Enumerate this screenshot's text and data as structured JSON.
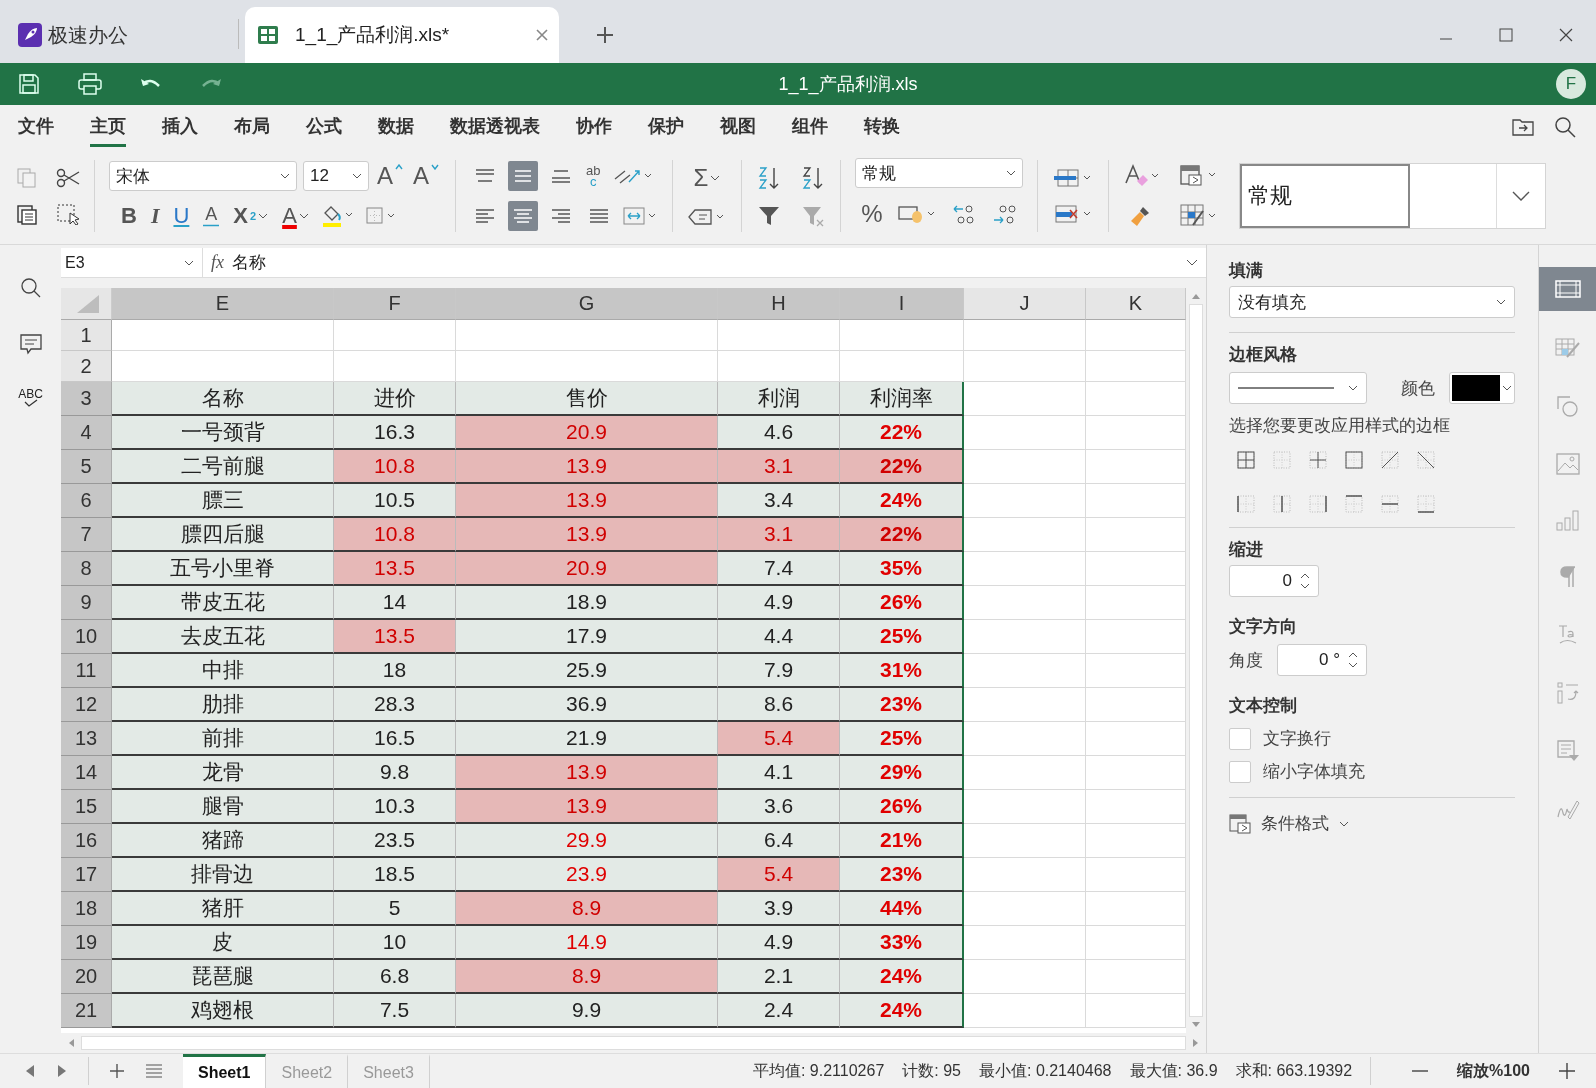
{
  "app_tab": {
    "label": "极速办公"
  },
  "doc_tab": {
    "label": "1_1_产品利润.xls*",
    "selected": true
  },
  "title_bar": {
    "title": "1_1_产品利润.xls",
    "avatar": "F",
    "redo_disabled": true
  },
  "menu": [
    {
      "label": "文件",
      "selected": false
    },
    {
      "label": "主页",
      "selected": true
    },
    {
      "label": "插入",
      "selected": false
    },
    {
      "label": "布局",
      "selected": false
    },
    {
      "label": "公式",
      "selected": false
    },
    {
      "label": "数据",
      "selected": false
    },
    {
      "label": "数据透视表",
      "selected": false
    },
    {
      "label": "协作",
      "selected": false
    },
    {
      "label": "保护",
      "selected": false
    },
    {
      "label": "视图",
      "selected": false
    },
    {
      "label": "组件",
      "selected": false
    },
    {
      "label": "转换",
      "selected": false
    }
  ],
  "toolbar": {
    "font": "宋体",
    "size": "12",
    "grow": "A",
    "shrink": "A",
    "bold": "B",
    "italic": "I",
    "underline": "U",
    "strike": "A",
    "subscript": "X",
    "subscript_mark": "2",
    "font_color": "A",
    "wrap_top": "ab",
    "wrap_bottom": "c",
    "sum": "Σ",
    "percent": "%",
    "number_format": "常规",
    "style_preview": "常规",
    "vertical_align": [
      {
        "selected": false
      },
      {
        "selected": true
      },
      {
        "selected": false
      }
    ],
    "horizontal_align": [
      {
        "selected": false
      },
      {
        "selected": true
      },
      {
        "selected": false
      },
      {
        "selected": false
      }
    ]
  },
  "formula_bar": {
    "cell": "E3",
    "fx": "fx",
    "value": "名称"
  },
  "side_tools": {
    "spell": "ABC"
  },
  "columns": [
    {
      "label": "E",
      "selected": true
    },
    {
      "label": "F",
      "selected": true
    },
    {
      "label": "G",
      "selected": true
    },
    {
      "label": "H",
      "selected": true
    },
    {
      "label": "I",
      "selected": true
    },
    {
      "label": "J",
      "selected": false
    },
    {
      "label": "K",
      "selected": false
    }
  ],
  "rows": [
    {
      "header": "1",
      "selected": false,
      "kind": "blank"
    },
    {
      "header": "2",
      "selected": false,
      "kind": "blank"
    },
    {
      "header": "3",
      "selected": true,
      "kind": "header",
      "cells": [
        {
          "text": "名称",
          "highlight": false,
          "red_text": false
        },
        {
          "text": "进价",
          "highlight": false,
          "red_text": false
        },
        {
          "text": "售价",
          "highlight": false,
          "red_text": false
        },
        {
          "text": "利润",
          "highlight": false,
          "red_text": false
        },
        {
          "text": "利润率",
          "highlight": false,
          "red_text": false
        }
      ]
    },
    {
      "header": "4",
      "selected": true,
      "kind": "data",
      "cells": [
        {
          "text": "一号颈背",
          "highlight": false,
          "red_text": false
        },
        {
          "text": "16.3",
          "highlight": false,
          "red_text": false
        },
        {
          "text": "20.9",
          "highlight": true,
          "red_text": true
        },
        {
          "text": "4.6",
          "highlight": false,
          "red_text": false
        },
        {
          "text": "22%",
          "highlight": false,
          "red_text": true
        }
      ]
    },
    {
      "header": "5",
      "selected": true,
      "kind": "data",
      "cells": [
        {
          "text": "二号前腿",
          "highlight": false,
          "red_text": false
        },
        {
          "text": "10.8",
          "highlight": true,
          "red_text": true
        },
        {
          "text": "13.9",
          "highlight": true,
          "red_text": true
        },
        {
          "text": "3.1",
          "highlight": true,
          "red_text": true
        },
        {
          "text": "22%",
          "highlight": true,
          "red_text": true
        }
      ]
    },
    {
      "header": "6",
      "selected": true,
      "kind": "data",
      "cells": [
        {
          "text": "膘三",
          "highlight": false,
          "red_text": false
        },
        {
          "text": "10.5",
          "highlight": false,
          "red_text": false
        },
        {
          "text": "13.9",
          "highlight": true,
          "red_text": true
        },
        {
          "text": "3.4",
          "highlight": false,
          "red_text": false
        },
        {
          "text": "24%",
          "highlight": false,
          "red_text": true
        }
      ]
    },
    {
      "header": "7",
      "selected": true,
      "kind": "data",
      "cells": [
        {
          "text": "膘四后腿",
          "highlight": false,
          "red_text": false
        },
        {
          "text": "10.8",
          "highlight": true,
          "red_text": true
        },
        {
          "text": "13.9",
          "highlight": true,
          "red_text": true
        },
        {
          "text": "3.1",
          "highlight": true,
          "red_text": true
        },
        {
          "text": "22%",
          "highlight": true,
          "red_text": true
        }
      ]
    },
    {
      "header": "8",
      "selected": true,
      "kind": "data",
      "cells": [
        {
          "text": "五号小里脊",
          "highlight": false,
          "red_text": false
        },
        {
          "text": "13.5",
          "highlight": true,
          "red_text": true
        },
        {
          "text": "20.9",
          "highlight": true,
          "red_text": true
        },
        {
          "text": "7.4",
          "highlight": false,
          "red_text": false
        },
        {
          "text": "35%",
          "highlight": false,
          "red_text": true
        }
      ]
    },
    {
      "header": "9",
      "selected": true,
      "kind": "data",
      "cells": [
        {
          "text": "带皮五花",
          "highlight": false,
          "red_text": false
        },
        {
          "text": "14",
          "highlight": false,
          "red_text": false
        },
        {
          "text": "18.9",
          "highlight": false,
          "red_text": false
        },
        {
          "text": "4.9",
          "highlight": false,
          "red_text": false
        },
        {
          "text": "26%",
          "highlight": false,
          "red_text": true
        }
      ]
    },
    {
      "header": "10",
      "selected": true,
      "kind": "data",
      "cells": [
        {
          "text": "去皮五花",
          "highlight": false,
          "red_text": false
        },
        {
          "text": "13.5",
          "highlight": true,
          "red_text": true
        },
        {
          "text": "17.9",
          "highlight": false,
          "red_text": false
        },
        {
          "text": "4.4",
          "highlight": false,
          "red_text": false
        },
        {
          "text": "25%",
          "highlight": false,
          "red_text": true
        }
      ]
    },
    {
      "header": "11",
      "selected": true,
      "kind": "data",
      "cells": [
        {
          "text": "中排",
          "highlight": false,
          "red_text": false
        },
        {
          "text": "18",
          "highlight": false,
          "red_text": false
        },
        {
          "text": "25.9",
          "highlight": false,
          "red_text": false
        },
        {
          "text": "7.9",
          "highlight": false,
          "red_text": false
        },
        {
          "text": "31%",
          "highlight": false,
          "red_text": true
        }
      ]
    },
    {
      "header": "12",
      "selected": true,
      "kind": "data",
      "cells": [
        {
          "text": "肋排",
          "highlight": false,
          "red_text": false
        },
        {
          "text": "28.3",
          "highlight": false,
          "red_text": false
        },
        {
          "text": "36.9",
          "highlight": false,
          "red_text": false
        },
        {
          "text": "8.6",
          "highlight": false,
          "red_text": false
        },
        {
          "text": "23%",
          "highlight": false,
          "red_text": true
        }
      ]
    },
    {
      "header": "13",
      "selected": true,
      "kind": "data",
      "cells": [
        {
          "text": "前排",
          "highlight": false,
          "red_text": false
        },
        {
          "text": "16.5",
          "highlight": false,
          "red_text": false
        },
        {
          "text": "21.9",
          "highlight": false,
          "red_text": false
        },
        {
          "text": "5.4",
          "highlight": true,
          "red_text": true
        },
        {
          "text": "25%",
          "highlight": false,
          "red_text": true
        }
      ]
    },
    {
      "header": "14",
      "selected": true,
      "kind": "data",
      "cells": [
        {
          "text": "龙骨",
          "highlight": false,
          "red_text": false
        },
        {
          "text": "9.8",
          "highlight": false,
          "red_text": false
        },
        {
          "text": "13.9",
          "highlight": true,
          "red_text": true
        },
        {
          "text": "4.1",
          "highlight": false,
          "red_text": false
        },
        {
          "text": "29%",
          "highlight": false,
          "red_text": true
        }
      ]
    },
    {
      "header": "15",
      "selected": true,
      "kind": "data",
      "cells": [
        {
          "text": "腿骨",
          "highlight": false,
          "red_text": false
        },
        {
          "text": "10.3",
          "highlight": false,
          "red_text": false
        },
        {
          "text": "13.9",
          "highlight": true,
          "red_text": true
        },
        {
          "text": "3.6",
          "highlight": false,
          "red_text": false
        },
        {
          "text": "26%",
          "highlight": false,
          "red_text": true
        }
      ]
    },
    {
      "header": "16",
      "selected": true,
      "kind": "data",
      "cells": [
        {
          "text": "猪蹄",
          "highlight": false,
          "red_text": false
        },
        {
          "text": "23.5",
          "highlight": false,
          "red_text": false
        },
        {
          "text": "29.9",
          "highlight": false,
          "red_text": true
        },
        {
          "text": "6.4",
          "highlight": false,
          "red_text": false
        },
        {
          "text": "21%",
          "highlight": false,
          "red_text": true
        }
      ]
    },
    {
      "header": "17",
      "selected": true,
      "kind": "data",
      "cells": [
        {
          "text": "排骨边",
          "highlight": false,
          "red_text": false
        },
        {
          "text": "18.5",
          "highlight": false,
          "red_text": false
        },
        {
          "text": "23.9",
          "highlight": false,
          "red_text": true
        },
        {
          "text": "5.4",
          "highlight": true,
          "red_text": true
        },
        {
          "text": "23%",
          "highlight": false,
          "red_text": true
        }
      ]
    },
    {
      "header": "18",
      "selected": true,
      "kind": "data",
      "cells": [
        {
          "text": "猪肝",
          "highlight": false,
          "red_text": false
        },
        {
          "text": "5",
          "highlight": false,
          "red_text": false
        },
        {
          "text": "8.9",
          "highlight": true,
          "red_text": true
        },
        {
          "text": "3.9",
          "highlight": false,
          "red_text": false
        },
        {
          "text": "44%",
          "highlight": false,
          "red_text": true
        }
      ]
    },
    {
      "header": "19",
      "selected": true,
      "kind": "data",
      "cells": [
        {
          "text": "皮",
          "highlight": false,
          "red_text": false
        },
        {
          "text": "10",
          "highlight": false,
          "red_text": false
        },
        {
          "text": "14.9",
          "highlight": false,
          "red_text": true
        },
        {
          "text": "4.9",
          "highlight": false,
          "red_text": false
        },
        {
          "text": "33%",
          "highlight": false,
          "red_text": true
        }
      ]
    },
    {
      "header": "20",
      "selected": true,
      "kind": "data",
      "cells": [
        {
          "text": "琵琶腿",
          "highlight": false,
          "red_text": false
        },
        {
          "text": "6.8",
          "highlight": false,
          "red_text": false
        },
        {
          "text": "8.9",
          "highlight": true,
          "red_text": true
        },
        {
          "text": "2.1",
          "highlight": false,
          "red_text": false
        },
        {
          "text": "24%",
          "highlight": false,
          "red_text": true
        }
      ]
    },
    {
      "header": "21",
      "selected": true,
      "kind": "data",
      "cells": [
        {
          "text": "鸡翅根",
          "highlight": false,
          "red_text": false
        },
        {
          "text": "7.5",
          "highlight": false,
          "red_text": false
        },
        {
          "text": "9.9",
          "highlight": false,
          "red_text": false
        },
        {
          "text": "2.4",
          "highlight": false,
          "red_text": false
        },
        {
          "text": "24%",
          "highlight": false,
          "red_text": true
        }
      ]
    }
  ],
  "format_panel": {
    "fill_title": "填满",
    "fill_value": "没有填充",
    "border_title": "边框风格",
    "color_label": "颜色",
    "border_hint": "选择您要更改应用样式的边框",
    "indent_title": "缩进",
    "indent_value": "0",
    "direction_title": "文字方向",
    "angle_label": "角度",
    "angle_value": "0 °",
    "text_control_title": "文本控制",
    "checkboxes": [
      {
        "label": "文字换行",
        "checked": false
      },
      {
        "label": "缩小字体填充",
        "checked": false
      }
    ],
    "conditional_format": "条件格式"
  },
  "sheets": [
    {
      "label": "Sheet1",
      "selected": true
    },
    {
      "label": "Sheet2",
      "selected": false
    },
    {
      "label": "Sheet3",
      "selected": false
    }
  ],
  "status": [
    {
      "label": "平均值: 9.2110267"
    },
    {
      "label": "计数: 95"
    },
    {
      "label": "最小值: 0.2140468"
    },
    {
      "label": "最大值: 36.9"
    },
    {
      "label": "求和: 663.19392"
    }
  ],
  "zoom": "缩放%100"
}
